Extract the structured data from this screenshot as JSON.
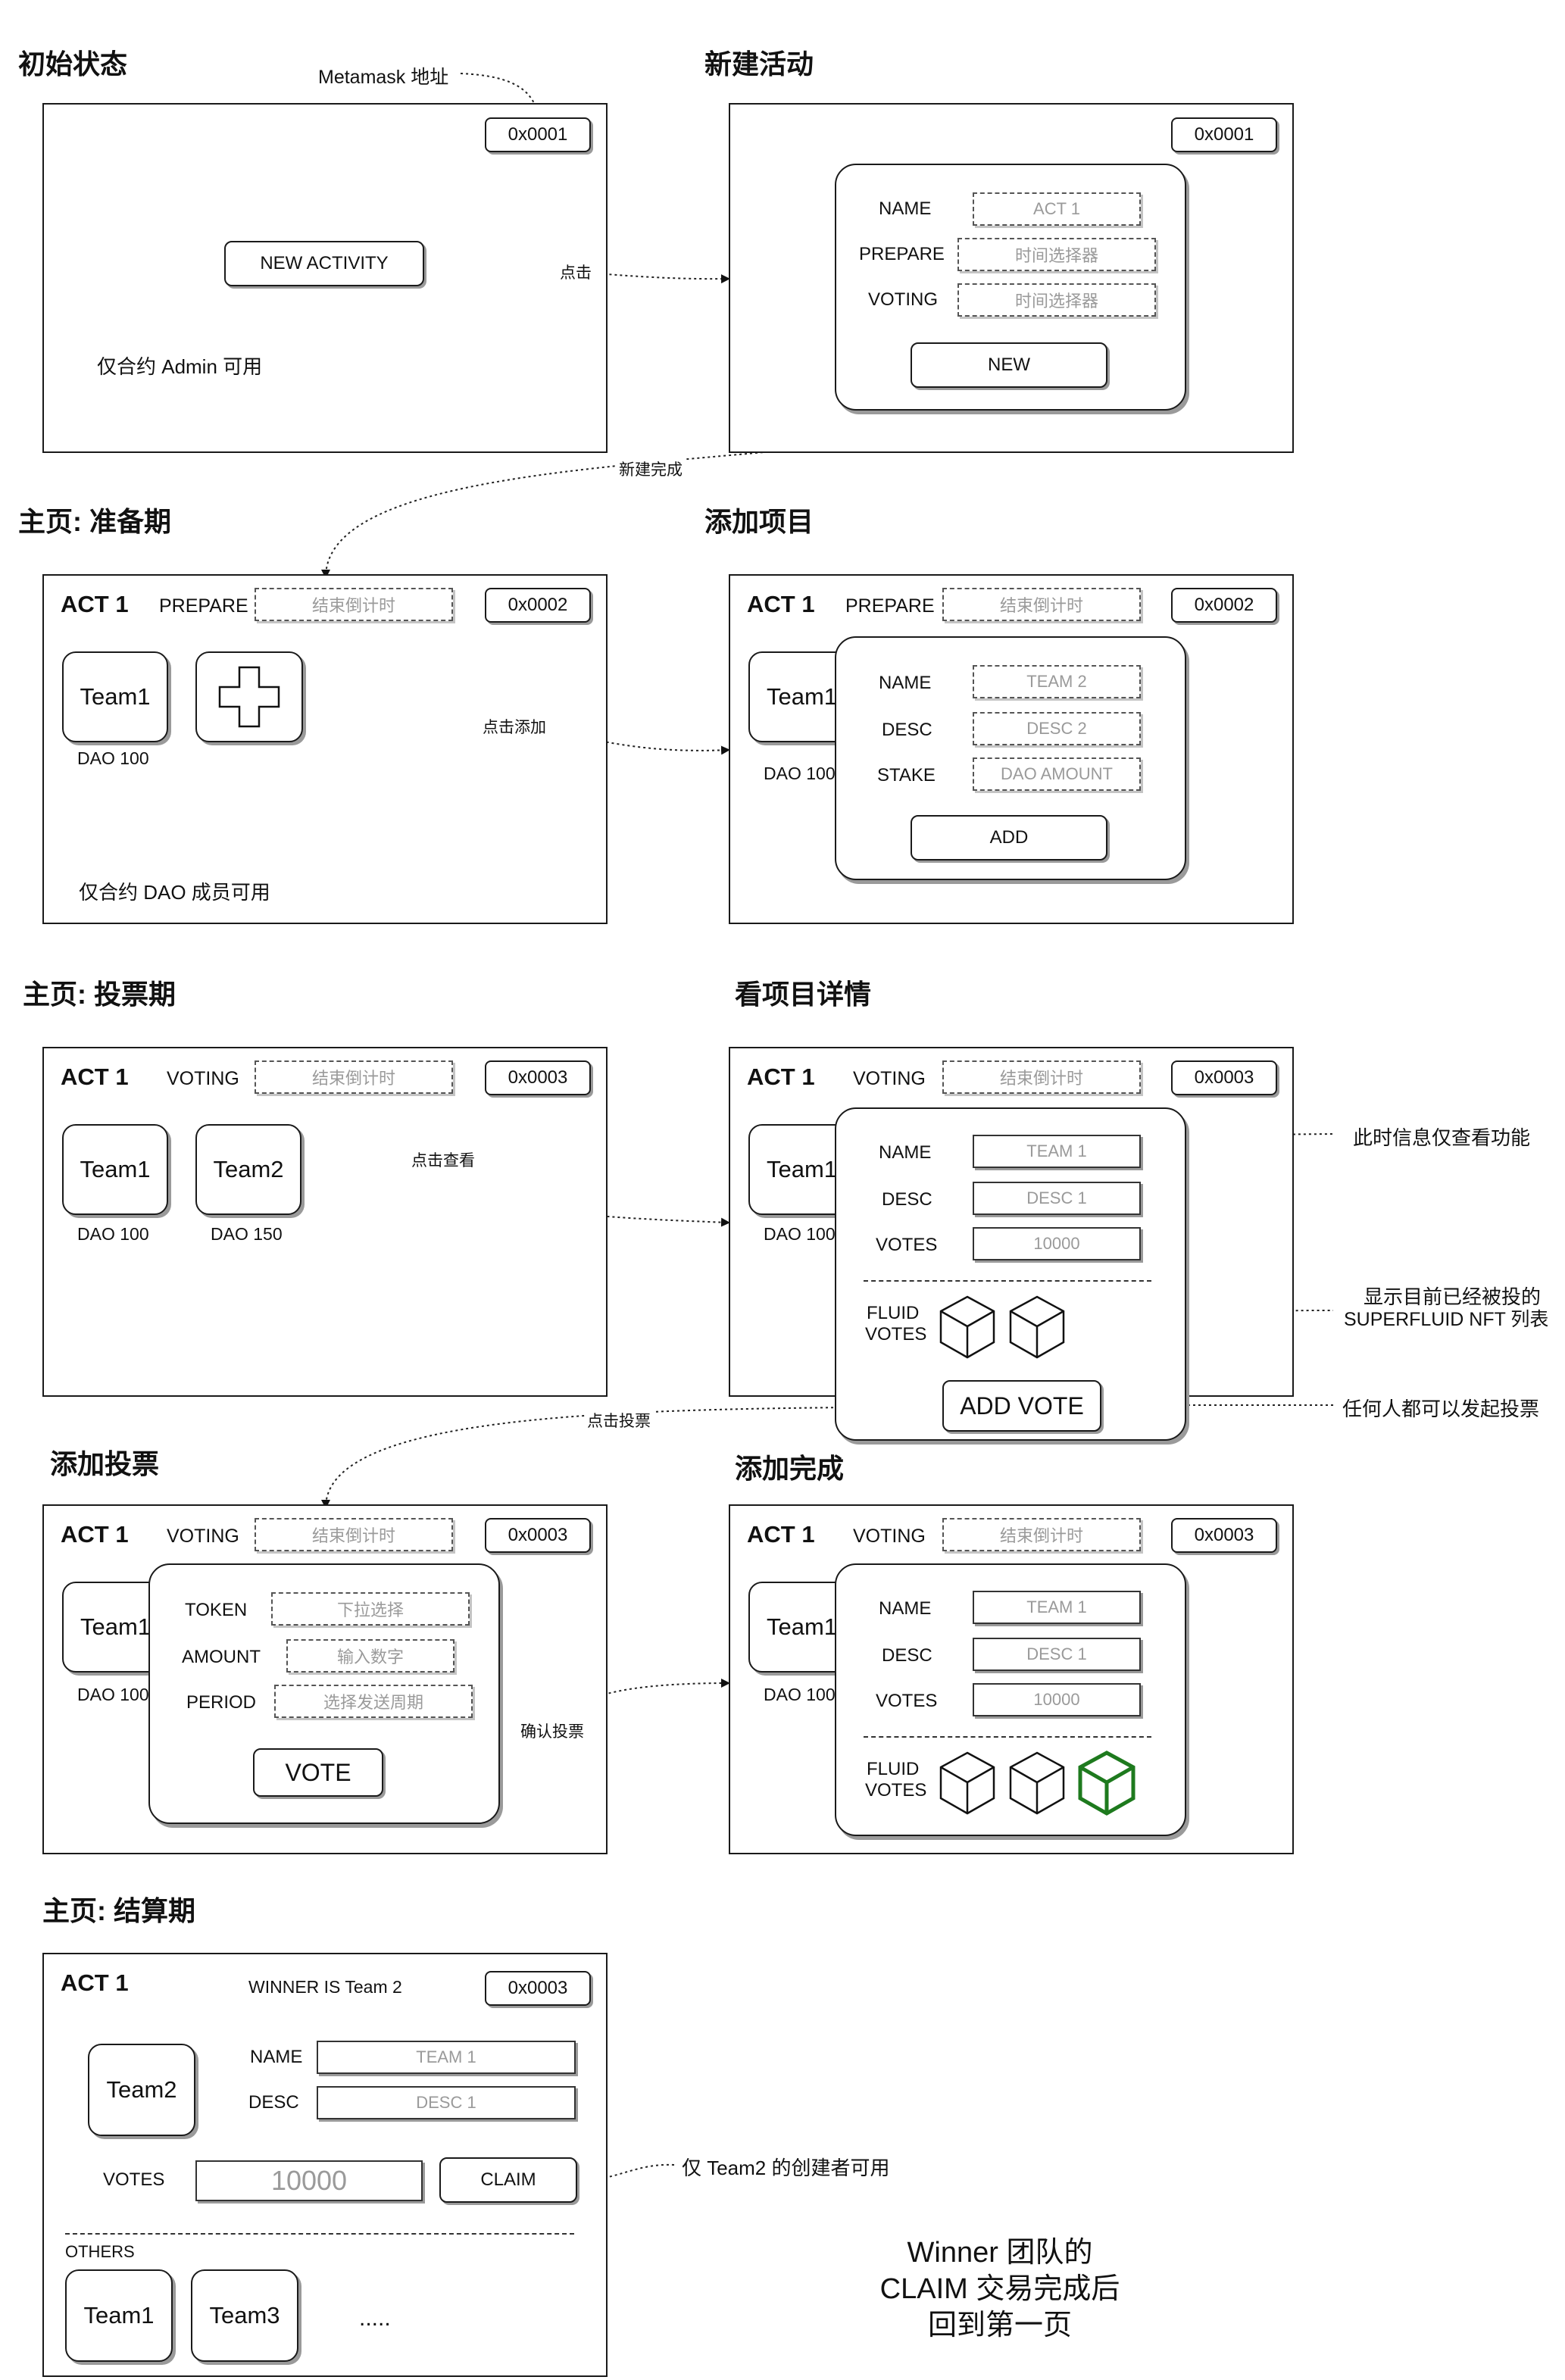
{
  "colors": {
    "line": "#1a1a1a",
    "placeholder": "#9a9a9a",
    "accent_green": "#1e7a1e"
  },
  "sections": {
    "initial": {
      "title": "初始状态",
      "address": "0x0001",
      "button": "NEW ACTIVITY",
      "note_metamask": "Metamask 地址",
      "note_admin": "仅合约 Admin 可用"
    },
    "new_activity": {
      "title": "新建活动",
      "address": "0x0001",
      "labels": [
        "NAME",
        "PREPARE",
        "VOTING"
      ],
      "placeholders": [
        "ACT 1",
        "时间选择器",
        "时间选择器"
      ],
      "button": "NEW"
    },
    "prepare_home": {
      "title": "主页: 准备期",
      "act": "ACT 1",
      "phase": "PREPARE",
      "countdown": "结束倒计时",
      "address": "0x0002",
      "team": "Team1",
      "team_dao": "DAO 100",
      "note_dao": "仅合约 DAO 成员可用"
    },
    "add_project": {
      "title": "添加项目",
      "act": "ACT 1",
      "phase": "PREPARE",
      "countdown": "结束倒计时",
      "address": "0x0002",
      "team": "Team1",
      "team_dao": "DAO 100",
      "labels": [
        "NAME",
        "DESC",
        "STAKE"
      ],
      "placeholders": [
        "TEAM 2",
        "DESC 2",
        "DAO AMOUNT"
      ],
      "button": "ADD"
    },
    "voting_home": {
      "title": "主页: 投票期",
      "act": "ACT 1",
      "phase": "VOTING",
      "countdown": "结束倒计时",
      "address": "0x0003",
      "teams": [
        {
          "name": "Team1",
          "dao": "DAO 100"
        },
        {
          "name": "Team2",
          "dao": "DAO 150"
        }
      ]
    },
    "project_detail": {
      "title": "看项目详情",
      "act": "ACT 1",
      "phase": "VOTING",
      "countdown": "结束倒计时",
      "address": "0x0003",
      "team": "Team1",
      "team_dao": "DAO 100",
      "labels": [
        "NAME",
        "DESC",
        "VOTES"
      ],
      "values": [
        "TEAM 1",
        "DESC 1",
        "10000"
      ],
      "fluid_label_1": "FLUID",
      "fluid_label_2": "VOTES",
      "button": "ADD VOTE",
      "note_readonly": "此时信息仅查看功能",
      "note_nft_1": "显示目前已经被投的",
      "note_nft_2": "SUPERFLUID NFT 列表",
      "note_anyone": "任何人都可以发起投票"
    },
    "add_vote": {
      "title": "添加投票",
      "act": "ACT 1",
      "phase": "VOTING",
      "countdown": "结束倒计时",
      "address": "0x0003",
      "team": "Team1",
      "team_dao": "DAO 100",
      "labels": [
        "TOKEN",
        "AMOUNT",
        "PERIOD"
      ],
      "placeholders": [
        "下拉选择",
        "输入数字",
        "选择发送周期"
      ],
      "button": "VOTE"
    },
    "vote_done": {
      "title": "添加完成",
      "act": "ACT 1",
      "phase": "VOTING",
      "countdown": "结束倒计时",
      "address": "0x0003",
      "team": "Team1",
      "team_dao": "DAO 100",
      "labels": [
        "NAME",
        "DESC",
        "VOTES"
      ],
      "values": [
        "TEAM 1",
        "DESC 1",
        "10000"
      ],
      "fluid_label_1": "FLUID",
      "fluid_label_2": "VOTES"
    },
    "settlement": {
      "title": "主页: 结算期",
      "act": "ACT 1",
      "winner": "WINNER IS Team 2",
      "address": "0x0003",
      "team": "Team2",
      "labels": [
        "NAME",
        "DESC"
      ],
      "values": [
        "TEAM 1",
        "DESC 1"
      ],
      "votes_label": "VOTES",
      "votes_value": "10000",
      "claim": "CLAIM",
      "others": "OTHERS",
      "other_teams": [
        "Team1",
        "Team3"
      ],
      "more": ".....",
      "note_claim": "仅 Team2 的创建者可用"
    }
  },
  "connectors": {
    "click": "点击",
    "created": "新建完成",
    "click_add": "点击添加",
    "click_view": "点击查看",
    "click_vote": "点击投票",
    "confirm_vote": "确认投票"
  },
  "final_note": {
    "line1": "Winner 团队的",
    "line2": "CLAIM 交易完成后",
    "line3": "回到第一页"
  }
}
